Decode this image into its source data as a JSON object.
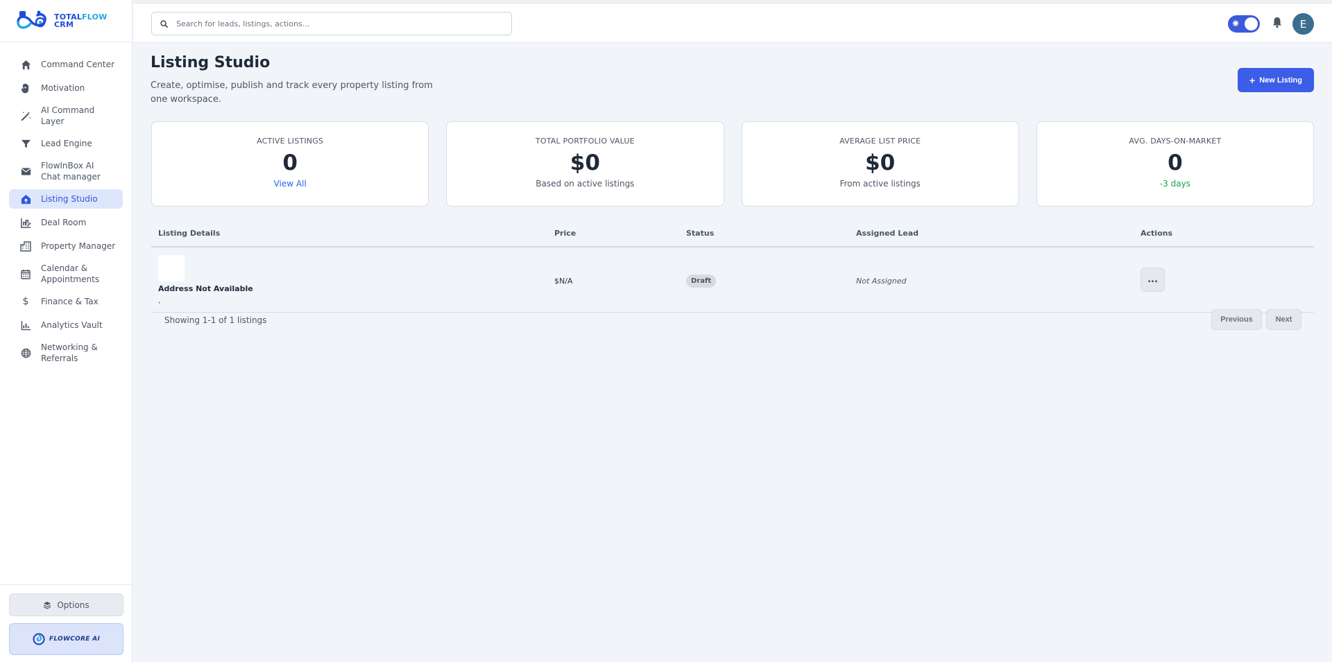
{
  "brand": {
    "line1": "TOTAL",
    "line1b": "FLOW",
    "line2": "CRM"
  },
  "search": {
    "placeholder": "Search for leads, listings, actions..."
  },
  "header": {
    "avatar_initial": "E"
  },
  "sidebar": {
    "items": [
      {
        "label": "Command Center",
        "icon": "home-icon"
      },
      {
        "label": "Motivation",
        "icon": "hand-icon"
      },
      {
        "label": "AI Command Layer",
        "icon": "magic-wand-icon"
      },
      {
        "label": "Lead Engine",
        "icon": "funnel-icon"
      },
      {
        "label": "FlowInBox AI Chat manager",
        "icon": "mail-icon"
      },
      {
        "label": "Listing Studio",
        "icon": "house-upload-icon",
        "active": true
      },
      {
        "label": "Deal Room",
        "icon": "deal-icon"
      },
      {
        "label": "Property Manager",
        "icon": "building-icon"
      },
      {
        "label": "Calendar & Appointments",
        "icon": "calendar-icon"
      },
      {
        "label": "Finance & Tax",
        "icon": "dollar-icon"
      },
      {
        "label": "Analytics Vault",
        "icon": "chart-icon"
      },
      {
        "label": "Networking & Referrals",
        "icon": "globe-icon"
      }
    ],
    "options_label": "Options",
    "flowcore_label": "FLOWCORE AI"
  },
  "page": {
    "title": "Listing Studio",
    "subtitle": "Create, optimise, publish and track every property listing from one workspace.",
    "new_listing_label": "New Listing"
  },
  "stats": [
    {
      "label": "ACTIVE LISTINGS",
      "value": "0",
      "foot": "View All"
    },
    {
      "label": "TOTAL PORTFOLIO VALUE",
      "value": "$0",
      "foot": "Based on active listings"
    },
    {
      "label": "AVERAGE LIST PRICE",
      "value": "$0",
      "foot": "From active listings"
    },
    {
      "label": "AVG. DAYS-ON-MARKET",
      "value": "0",
      "foot": "-3 days"
    }
  ],
  "table": {
    "headers": [
      "Listing Details",
      "Price",
      "Status",
      "Assigned Lead",
      "Actions"
    ],
    "rows": [
      {
        "address": "Address Not Available",
        "address_line2": ",",
        "price": "$N/A",
        "status": "Draft",
        "lead": "Not Assigned",
        "actions_label": "..."
      }
    ]
  },
  "pager": {
    "showing": "Showing 1-1 of 1 listings",
    "prev": "Previous",
    "next": "Next"
  },
  "colors": {
    "accent": "#3b5de7",
    "active_bg": "#dde6fb",
    "positive": "#16a34a"
  }
}
